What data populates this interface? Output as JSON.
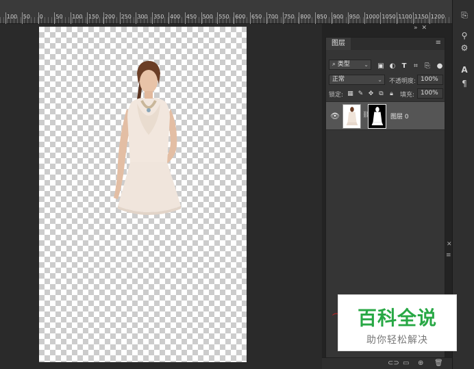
{
  "ruler": {
    "labels": [
      "100",
      "50",
      "0",
      "50",
      "100",
      "150",
      "200",
      "250",
      "300",
      "350",
      "400",
      "450",
      "500",
      "550",
      "600",
      "650",
      "700",
      "750",
      "800",
      "850",
      "900",
      "950",
      "1000",
      "1050",
      "1100",
      "1150",
      "1200"
    ]
  },
  "layers_panel": {
    "tab_label": "图层",
    "filter_kind": "类型",
    "filter_icons": [
      "image-filter-icon",
      "adjustment-filter-icon",
      "type-filter-icon",
      "shape-filter-icon",
      "smart-object-filter-icon"
    ],
    "blend_mode": "正常",
    "opacity_label": "不透明度:",
    "opacity_value": "100%",
    "lock_label": "锁定:",
    "fill_label": "填充:",
    "fill_value": "100%",
    "layer": {
      "name": "图层 0",
      "visible": true
    }
  },
  "watermark": {
    "title": "百科全说",
    "subtitle": "助你轻松解决"
  },
  "colors": {
    "workspace": "#2a2a2a",
    "panel": "#353535",
    "selected_layer": "#555555",
    "watermark_green": "#28a845"
  }
}
